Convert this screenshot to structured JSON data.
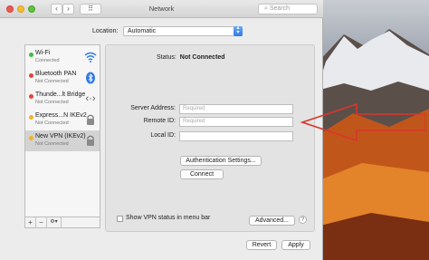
{
  "window": {
    "title": "Network"
  },
  "toolbar": {
    "back": "‹",
    "forward": "›",
    "grid": "⠿",
    "search_placeholder": "Search"
  },
  "location": {
    "label": "Location:",
    "value": "Automatic"
  },
  "services": [
    {
      "name": "Wi-Fi",
      "status": "Connected",
      "dot": "#3fbf3f",
      "icon": "wifi-icon"
    },
    {
      "name": "Bluetooth PAN",
      "status": "Not Connected",
      "dot": "#e2433c",
      "icon": "bluetooth-icon"
    },
    {
      "name": "Thunde...lt Bridge",
      "status": "Not Connected",
      "dot": "#e2433c",
      "icon": "thunderbolt-bridge-icon"
    },
    {
      "name": "Express...N IKEv2",
      "status": "Not Connected",
      "dot": "#f0b429",
      "icon": "lock-icon"
    },
    {
      "name": "New VPN (IKEv2)",
      "status": "Not Connected",
      "dot": "#f0b429",
      "icon": "lock-icon",
      "selected": true
    }
  ],
  "sidebar_buttons": {
    "add": "+",
    "remove": "−",
    "actions": "⚙▾"
  },
  "detail": {
    "status_label": "Status:",
    "status_value": "Not Connected",
    "server_label": "Server Address:",
    "server_placeholder": "Required",
    "remote_label": "Remote ID:",
    "remote_placeholder": "Required",
    "local_label": "Local ID:",
    "local_value": "",
    "auth_button": "Authentication Settings...",
    "connect_button": "Connect",
    "show_vpn_label": "Show VPN status in menu bar",
    "show_vpn_checked": false,
    "advanced_button": "Advanced...",
    "help": "?"
  },
  "footer": {
    "revert": "Revert",
    "apply": "Apply"
  },
  "colors": {
    "accent": "#2f79e4",
    "annotation_arrow": "#d9362b"
  }
}
